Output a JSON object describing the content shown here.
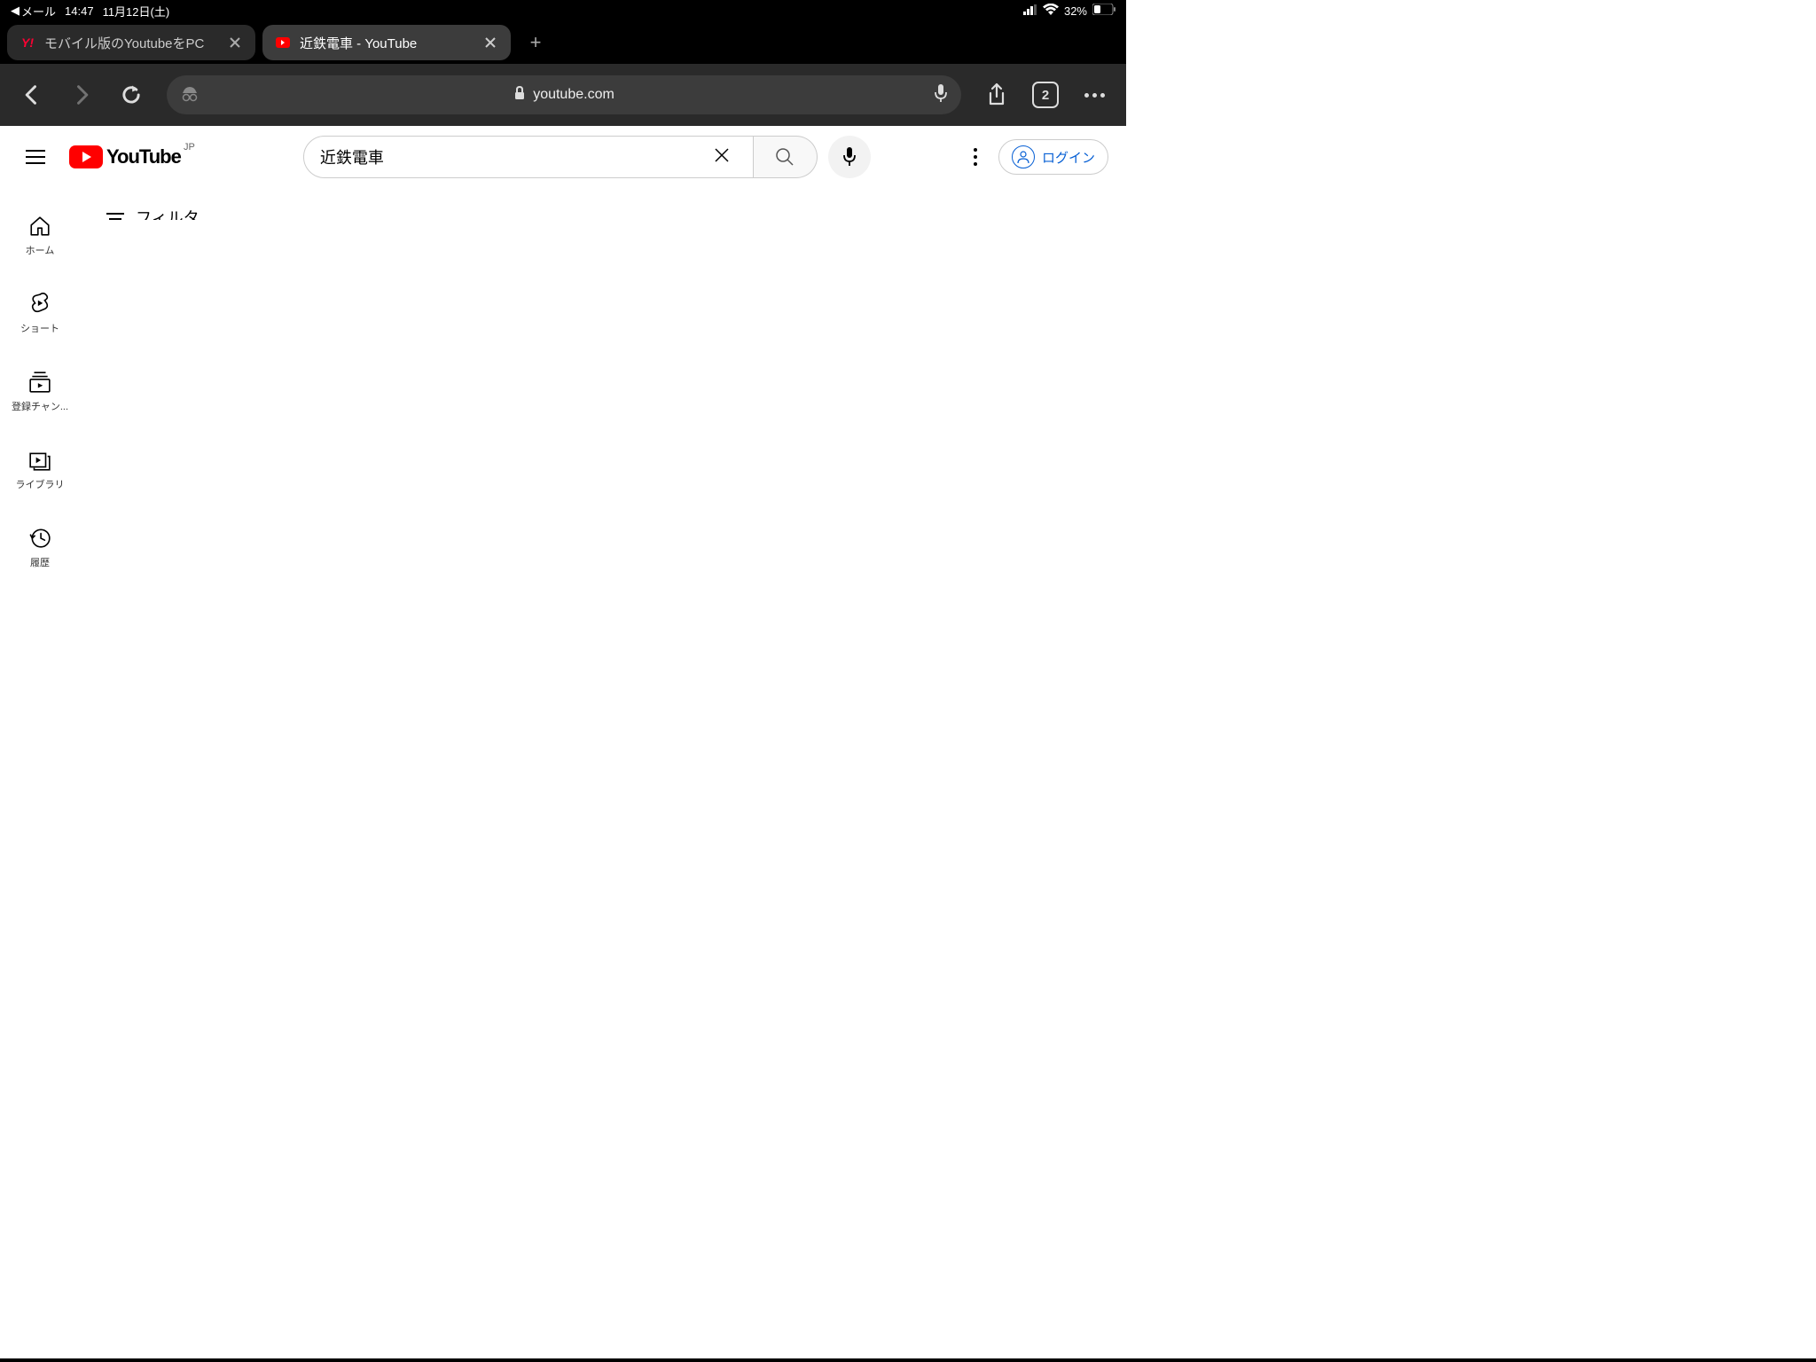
{
  "status_bar": {
    "back_app": "メール",
    "time": "14:47",
    "date": "11月12日(土)",
    "battery_pct": "32%"
  },
  "browser": {
    "tabs": [
      {
        "title": "モバイル版のYoutubeをPC",
        "active": false
      },
      {
        "title": "近鉄電車 - YouTube",
        "active": true
      }
    ],
    "url": "youtube.com",
    "tab_count": "2"
  },
  "youtube": {
    "logo_text": "YouTube",
    "country": "JP",
    "search_value": "近鉄電車",
    "login_label": "ログイン",
    "sidebar": [
      {
        "label": "ホーム"
      },
      {
        "label": "ショート"
      },
      {
        "label": "登録チャン..."
      },
      {
        "label": "ライブラリ"
      },
      {
        "label": "履歴"
      }
    ],
    "filter_partial": "フィルタ"
  }
}
